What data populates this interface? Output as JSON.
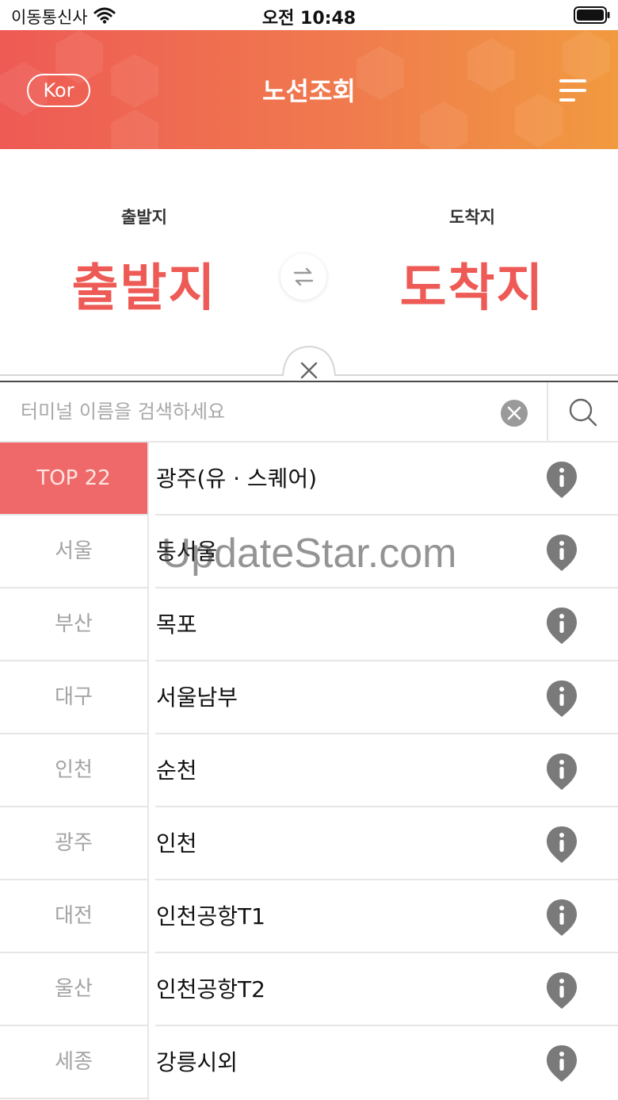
{
  "status_bar": {
    "carrier": "이동통신사",
    "time": "오전 10:48"
  },
  "header": {
    "language_button": "Kor",
    "title": "노선조회"
  },
  "route": {
    "departure_label": "출발지",
    "departure_value": "출발지",
    "arrival_label": "도착지",
    "arrival_value": "도착지"
  },
  "search": {
    "placeholder": "터미널 이름을 검색하세요",
    "value": ""
  },
  "regions": [
    {
      "label": "TOP 22",
      "active": true
    },
    {
      "label": "서울",
      "active": false
    },
    {
      "label": "부산",
      "active": false
    },
    {
      "label": "대구",
      "active": false
    },
    {
      "label": "인천",
      "active": false
    },
    {
      "label": "광주",
      "active": false
    },
    {
      "label": "대전",
      "active": false
    },
    {
      "label": "울산",
      "active": false
    },
    {
      "label": "세종",
      "active": false
    }
  ],
  "terminals": [
    "광주(유 · 스퀘어)",
    "동서울",
    "목포",
    "서울남부",
    "순천",
    "인천",
    "인천공항T1",
    "인천공항T2",
    "강릉시외"
  ],
  "watermark": "UpdateStar.com",
  "colors": {
    "accent": "#ee5a55",
    "accent_end": "#f19a40",
    "active_region": "#f0696a",
    "info_icon": "#7a7a7a"
  },
  "icons": [
    "wifi-icon",
    "battery-icon",
    "menu-icon",
    "swap-arrows-icon",
    "close-icon",
    "clear-icon",
    "search-icon",
    "info-icon"
  ]
}
